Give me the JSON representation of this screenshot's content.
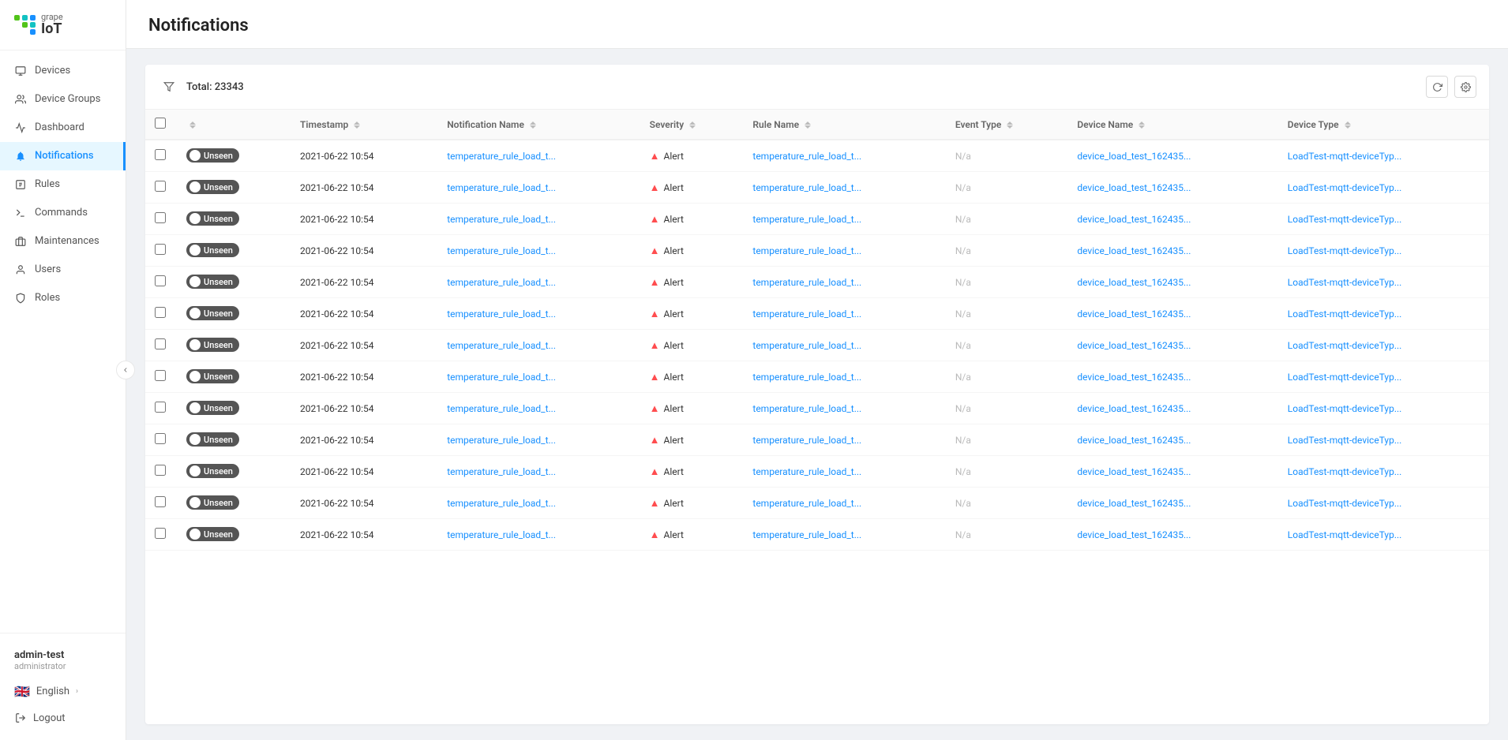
{
  "app": {
    "name": "grape",
    "subtitle": "IoT"
  },
  "sidebar": {
    "items": [
      {
        "id": "devices",
        "label": "Devices",
        "icon": "device-icon",
        "active": false
      },
      {
        "id": "device-groups",
        "label": "Device Groups",
        "icon": "groups-icon",
        "active": false
      },
      {
        "id": "dashboard",
        "label": "Dashboard",
        "icon": "dashboard-icon",
        "active": false
      },
      {
        "id": "notifications",
        "label": "Notifications",
        "icon": "bell-icon",
        "active": true
      },
      {
        "id": "rules",
        "label": "Rules",
        "icon": "rules-icon",
        "active": false
      },
      {
        "id": "commands",
        "label": "Commands",
        "icon": "commands-icon",
        "active": false
      },
      {
        "id": "maintenances",
        "label": "Maintenances",
        "icon": "maintenance-icon",
        "active": false
      },
      {
        "id": "users",
        "label": "Users",
        "icon": "users-icon",
        "active": false
      },
      {
        "id": "roles",
        "label": "Roles",
        "icon": "roles-icon",
        "active": false
      }
    ],
    "user": {
      "name": "admin-test",
      "role": "administrator"
    },
    "language": {
      "label": "English",
      "flag": "🇬🇧"
    },
    "logout_label": "Logout"
  },
  "page": {
    "title": "Notifications"
  },
  "toolbar": {
    "total_label": "Total: 23343",
    "refresh_title": "Refresh",
    "settings_title": "Settings"
  },
  "table": {
    "columns": [
      {
        "id": "checkbox",
        "label": ""
      },
      {
        "id": "status",
        "label": "",
        "sortable": true
      },
      {
        "id": "timestamp",
        "label": "Timestamp",
        "sortable": true
      },
      {
        "id": "notification_name",
        "label": "Notification Name",
        "sortable": true
      },
      {
        "id": "severity",
        "label": "Severity",
        "sortable": true
      },
      {
        "id": "rule_name",
        "label": "Rule Name",
        "sortable": true
      },
      {
        "id": "event_type",
        "label": "Event Type",
        "sortable": true
      },
      {
        "id": "device_name",
        "label": "Device Name",
        "sortable": true
      },
      {
        "id": "device_type",
        "label": "Device Type",
        "sortable": true
      }
    ],
    "rows": [
      {
        "id": 1,
        "status": "Unseen",
        "timestamp": "2021-06-22 10:54",
        "notification_name": "temperature_rule_load_t...",
        "severity": "Alert",
        "rule_name": "temperature_rule_load_t...",
        "event_type": "N/a",
        "device_name": "device_load_test_162435...",
        "device_type": "LoadTest-mqtt-deviceTyp..."
      },
      {
        "id": 2,
        "status": "Unseen",
        "timestamp": "2021-06-22 10:54",
        "notification_name": "temperature_rule_load_t...",
        "severity": "Alert",
        "rule_name": "temperature_rule_load_t...",
        "event_type": "N/a",
        "device_name": "device_load_test_162435...",
        "device_type": "LoadTest-mqtt-deviceTyp..."
      },
      {
        "id": 3,
        "status": "Unseen",
        "timestamp": "2021-06-22 10:54",
        "notification_name": "temperature_rule_load_t...",
        "severity": "Alert",
        "rule_name": "temperature_rule_load_t...",
        "event_type": "N/a",
        "device_name": "device_load_test_162435...",
        "device_type": "LoadTest-mqtt-deviceTyp..."
      },
      {
        "id": 4,
        "status": "Unseen",
        "timestamp": "2021-06-22 10:54",
        "notification_name": "temperature_rule_load_t...",
        "severity": "Alert",
        "rule_name": "temperature_rule_load_t...",
        "event_type": "N/a",
        "device_name": "device_load_test_162435...",
        "device_type": "LoadTest-mqtt-deviceTyp..."
      },
      {
        "id": 5,
        "status": "Unseen",
        "timestamp": "2021-06-22 10:54",
        "notification_name": "temperature_rule_load_t...",
        "severity": "Alert",
        "rule_name": "temperature_rule_load_t...",
        "event_type": "N/a",
        "device_name": "device_load_test_162435...",
        "device_type": "LoadTest-mqtt-deviceTyp..."
      },
      {
        "id": 6,
        "status": "Unseen",
        "timestamp": "2021-06-22 10:54",
        "notification_name": "temperature_rule_load_t...",
        "severity": "Alert",
        "rule_name": "temperature_rule_load_t...",
        "event_type": "N/a",
        "device_name": "device_load_test_162435...",
        "device_type": "LoadTest-mqtt-deviceTyp..."
      },
      {
        "id": 7,
        "status": "Unseen",
        "timestamp": "2021-06-22 10:54",
        "notification_name": "temperature_rule_load_t...",
        "severity": "Alert",
        "rule_name": "temperature_rule_load_t...",
        "event_type": "N/a",
        "device_name": "device_load_test_162435...",
        "device_type": "LoadTest-mqtt-deviceTyp..."
      },
      {
        "id": 8,
        "status": "Unseen",
        "timestamp": "2021-06-22 10:54",
        "notification_name": "temperature_rule_load_t...",
        "severity": "Alert",
        "rule_name": "temperature_rule_load_t...",
        "event_type": "N/a",
        "device_name": "device_load_test_162435...",
        "device_type": "LoadTest-mqtt-deviceTyp..."
      },
      {
        "id": 9,
        "status": "Unseen",
        "timestamp": "2021-06-22 10:54",
        "notification_name": "temperature_rule_load_t...",
        "severity": "Alert",
        "rule_name": "temperature_rule_load_t...",
        "event_type": "N/a",
        "device_name": "device_load_test_162435...",
        "device_type": "LoadTest-mqtt-deviceTyp..."
      },
      {
        "id": 10,
        "status": "Unseen",
        "timestamp": "2021-06-22 10:54",
        "notification_name": "temperature_rule_load_t...",
        "severity": "Alert",
        "rule_name": "temperature_rule_load_t...",
        "event_type": "N/a",
        "device_name": "device_load_test_162435...",
        "device_type": "LoadTest-mqtt-deviceTyp..."
      },
      {
        "id": 11,
        "status": "Unseen",
        "timestamp": "2021-06-22 10:54",
        "notification_name": "temperature_rule_load_t...",
        "severity": "Alert",
        "rule_name": "temperature_rule_load_t...",
        "event_type": "N/a",
        "device_name": "device_load_test_162435...",
        "device_type": "LoadTest-mqtt-deviceTyp..."
      },
      {
        "id": 12,
        "status": "Unseen",
        "timestamp": "2021-06-22 10:54",
        "notification_name": "temperature_rule_load_t...",
        "severity": "Alert",
        "rule_name": "temperature_rule_load_t...",
        "event_type": "N/a",
        "device_name": "device_load_test_162435...",
        "device_type": "LoadTest-mqtt-deviceTyp..."
      },
      {
        "id": 13,
        "status": "Unseen",
        "timestamp": "2021-06-22 10:54",
        "notification_name": "temperature_rule_load_t...",
        "severity": "Alert",
        "rule_name": "temperature_rule_load_t...",
        "event_type": "N/a",
        "device_name": "device_load_test_162435...",
        "device_type": "LoadTest-mqtt-deviceTyp..."
      }
    ]
  }
}
